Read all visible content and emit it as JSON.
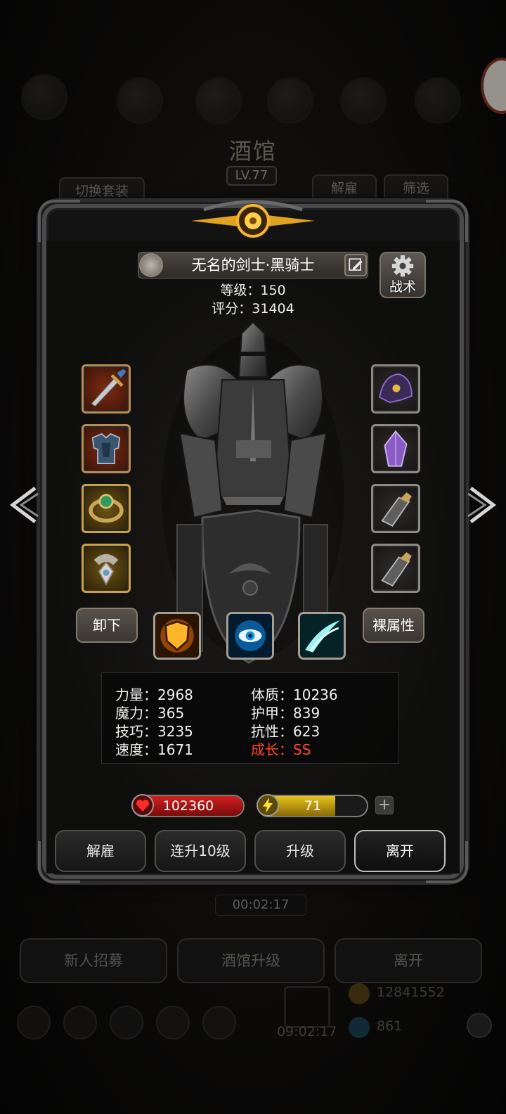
{
  "background": {
    "title": "酒馆",
    "level": "LV.77",
    "left_button": "切换套装",
    "right_buttons": [
      "解雇",
      "筛选"
    ],
    "timer": "00:02:17",
    "bottom_buttons": [
      "新人招募",
      "酒馆升级",
      "离开"
    ],
    "gold": "12841552",
    "gems": "861",
    "bottom_timer": "09:02:17"
  },
  "hero": {
    "name": "无名的剑士·黑骑士",
    "level_text": "等级：150",
    "score_text": "评分：31404",
    "tactics_label": "战术"
  },
  "equipment": {
    "left": [
      "sword-icon",
      "armor-icon",
      "ring-icon",
      "amulet-icon"
    ],
    "right": [
      "helmet-icon",
      "crystal-icon",
      "gauntlet-icon",
      "gauntlet-icon"
    ]
  },
  "actions_row": {
    "unequip": "卸下",
    "bare_stats": "裸属性",
    "skills": [
      "shield-skill-icon",
      "eye-skill-icon",
      "slash-skill-icon"
    ]
  },
  "stats": {
    "col1": [
      "力量：2968",
      "魔力：365",
      "技巧：3235",
      "速度：1671"
    ],
    "col2": [
      "体质：10236",
      "护甲：839",
      "抗性：623"
    ],
    "growth": "成长：SS"
  },
  "bars": {
    "hp": "102360",
    "hp_fill": 1.0,
    "energy": "71",
    "energy_fill": 0.71,
    "colors": {
      "hp": "#d11f1f",
      "energy": "#e6c21a"
    }
  },
  "buttons": [
    "解雇",
    "连升10级",
    "升级",
    "离开"
  ]
}
